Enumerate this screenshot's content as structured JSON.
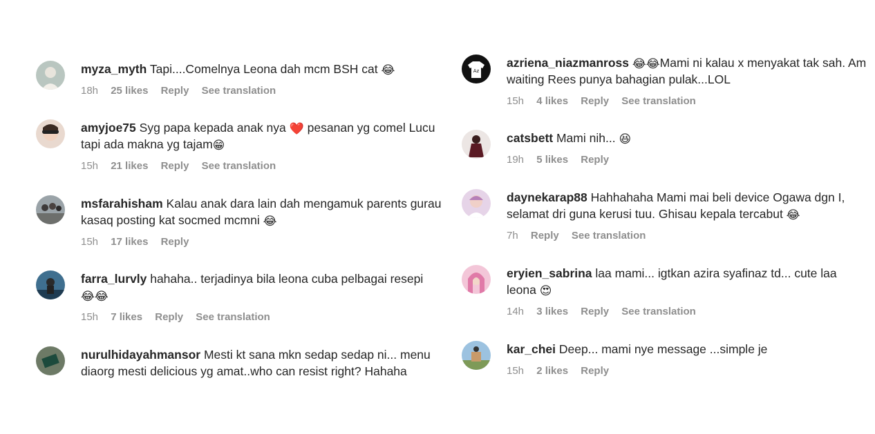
{
  "comments_left": [
    {
      "username": "myza_myth",
      "text": "Tapi....Comelnya Leona dah mcm BSH cat ",
      "emoji": "😂",
      "time": "18h",
      "likes": "25 likes",
      "reply": "Reply",
      "translate": "See translation"
    },
    {
      "username": "amyjoe75",
      "text": "Syg papa kepada anak nya ",
      "heart": "❤️",
      "text2": " pesanan yg comel Lucu tapi ada makna yg tajam",
      "emoji": "😁",
      "time": "15h",
      "likes": "21 likes",
      "reply": "Reply",
      "translate": "See translation"
    },
    {
      "username": "msfarahisham",
      "text": "Kalau anak dara lain dah mengamuk parents gurau kasaq posting kat socmed mcmni ",
      "emoji": "😂",
      "time": "15h",
      "likes": "17 likes",
      "reply": "Reply"
    },
    {
      "username": "farra_lurvly",
      "text": "hahaha.. terjadinya bila leona cuba pelbagai resepi ",
      "emoji": "😂😂",
      "time": "15h",
      "likes": "7 likes",
      "reply": "Reply",
      "translate": "See translation"
    },
    {
      "username": "nurulhidayahmansor",
      "text": "Mesti kt sana mkn sedap sedap ni... menu diaorg mesti delicious yg amat..who can resist right? Hahaha"
    }
  ],
  "comments_right": [
    {
      "username": "azriena_niazmanross",
      "emoji": "😂😂",
      "text": "Mami ni kalau x menyakat tak sah. Am waiting Rees punya bahagian pulak...LOL",
      "time": "15h",
      "likes": "4 likes",
      "reply": "Reply",
      "translate": "See translation"
    },
    {
      "username": "catsbett",
      "text": "Mami nih... ",
      "emoji": "😆",
      "time": "19h",
      "likes": "5 likes",
      "reply": "Reply"
    },
    {
      "username": "daynekarap88",
      "text": "Hahhahaha Mami mai beli device Ogawa dgn I, selamat dri guna kerusi tuu. Ghisau kepala tercabut ",
      "emoji": "😂",
      "time": "7h",
      "reply": "Reply",
      "translate": "See translation"
    },
    {
      "username": "eryien_sabrina",
      "text": "laa mami... igtkan azira syafinaz td... cute laa leona ",
      "emoji": "😍",
      "time": "14h",
      "likes": "3 likes",
      "reply": "Reply",
      "translate": "See translation"
    },
    {
      "username": "kar_chei",
      "text": "Deep... mami nye message ...simple je",
      "time": "15h",
      "likes": "2 likes",
      "reply": "Reply"
    }
  ],
  "colors": {
    "text": "#262626",
    "meta": "#8e8e8e",
    "background": "#ffffff"
  }
}
